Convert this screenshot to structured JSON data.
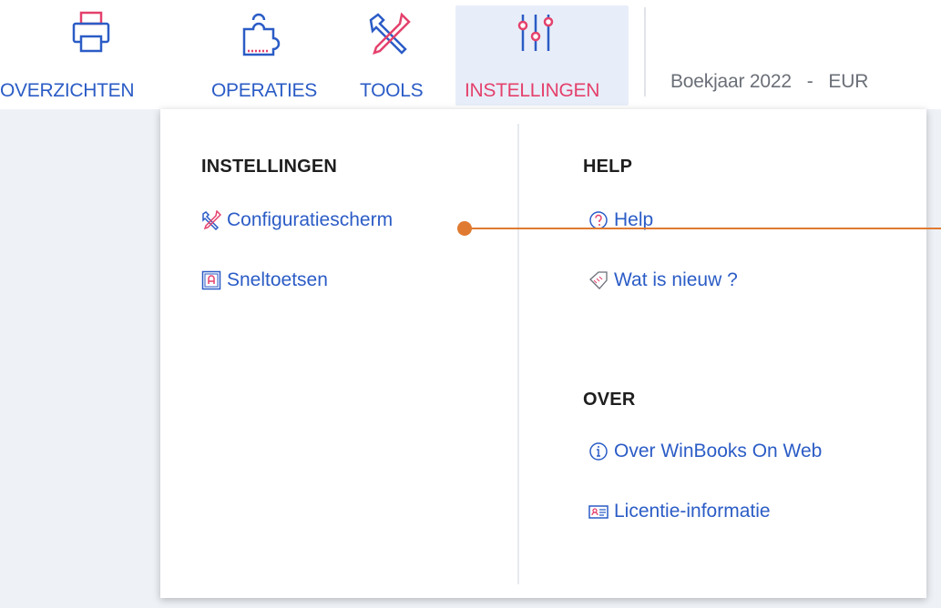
{
  "nav": {
    "items": [
      {
        "label": "OVERZICHTEN",
        "icon": "printer-icon"
      },
      {
        "label": "OPERATIES",
        "icon": "puzzle-icon"
      },
      {
        "label": "TOOLS",
        "icon": "tools-icon"
      },
      {
        "label": "INSTELLINGEN",
        "icon": "sliders-icon"
      }
    ],
    "active": "INSTELLINGEN",
    "boekjaar": "Boekjaar 2022   -   EUR"
  },
  "menu": {
    "instellingen": {
      "title": "INSTELLINGEN",
      "items": [
        {
          "label": "Configuratiescherm",
          "icon": "tools-icon"
        },
        {
          "label": "Sneltoetsen",
          "icon": "keyboard-key-icon"
        }
      ]
    },
    "help": {
      "title": "HELP",
      "items": [
        {
          "label": "Help",
          "icon": "question-circle-icon"
        },
        {
          "label": "Wat is nieuw ?",
          "icon": "new-tag-icon"
        }
      ]
    },
    "over": {
      "title": "OVER",
      "items": [
        {
          "label": "Over WinBooks On Web",
          "icon": "info-circle-icon"
        },
        {
          "label": "Licentie-informatie",
          "icon": "license-card-icon"
        }
      ]
    }
  },
  "colors": {
    "link": "#2b5cc6",
    "active": "#e4416c",
    "active_bg": "#e8eef9",
    "pointer": "#e07a30"
  }
}
